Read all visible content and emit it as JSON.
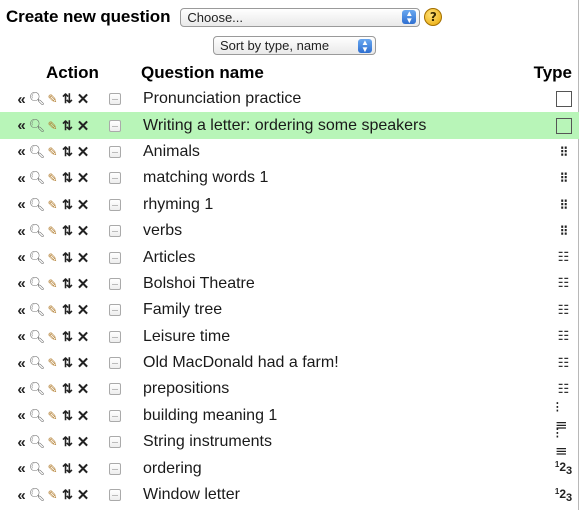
{
  "create": {
    "label": "Create new question",
    "select_value": "Choose...",
    "help_icon": "help-icon"
  },
  "sort": {
    "select_value": "Sort by type, name"
  },
  "columns": {
    "action": "Action",
    "name": "Question name",
    "type": "Type"
  },
  "highlight_color": "#b8f5b8",
  "questions": [
    {
      "name": "Pronunciation practice",
      "type_icon": "description-icon",
      "highlighted": false
    },
    {
      "name": "Writing a letter: ordering some speakers",
      "type_icon": "description-icon",
      "highlighted": true
    },
    {
      "name": "Animals",
      "type_icon": "matching-icon",
      "highlighted": false
    },
    {
      "name": "matching words 1",
      "type_icon": "matching-icon",
      "highlighted": false
    },
    {
      "name": "rhyming 1",
      "type_icon": "matching-icon",
      "highlighted": false
    },
    {
      "name": "verbs",
      "type_icon": "matching-icon",
      "highlighted": false
    },
    {
      "name": "Articles",
      "type_icon": "cloze-icon",
      "highlighted": false
    },
    {
      "name": "Bolshoi Theatre",
      "type_icon": "cloze-icon",
      "highlighted": false
    },
    {
      "name": "Family tree",
      "type_icon": "cloze-icon",
      "highlighted": false
    },
    {
      "name": "Leisure time",
      "type_icon": "cloze-icon",
      "highlighted": false
    },
    {
      "name": "Old MacDonald had a farm!",
      "type_icon": "cloze-icon",
      "highlighted": false
    },
    {
      "name": "prepositions",
      "type_icon": "cloze-icon",
      "highlighted": false
    },
    {
      "name": "building meaning 1",
      "type_icon": "multichoice-icon",
      "highlighted": false
    },
    {
      "name": "String instruments",
      "type_icon": "multichoice-icon",
      "highlighted": false
    },
    {
      "name": "ordering",
      "type_icon": "ordering-icon",
      "highlighted": false
    },
    {
      "name": "Window letter",
      "type_icon": "ordering-icon",
      "highlighted": false
    }
  ]
}
